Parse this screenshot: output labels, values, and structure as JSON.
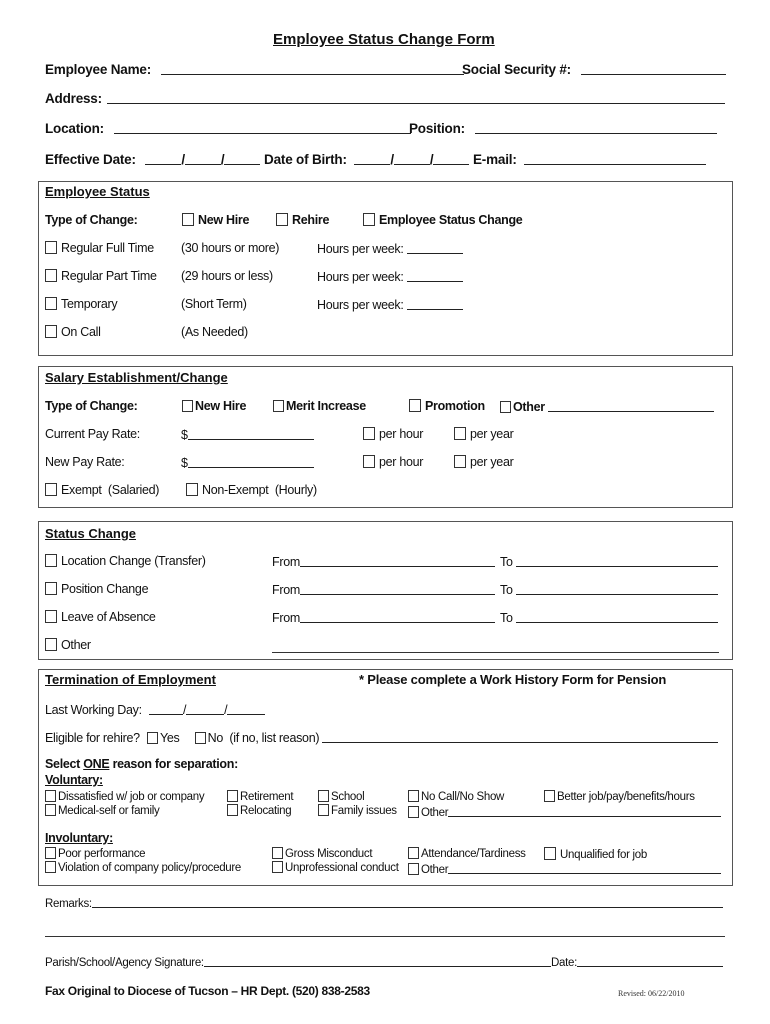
{
  "title": "Employee Status Change Form",
  "header_fields": {
    "employee_name": "Employee Name:",
    "ssn": "Social Security #:",
    "address": "Address:",
    "location": "Location:",
    "position": "Position:",
    "effective_date": "Effective Date:",
    "date_of_birth": "Date of Birth:",
    "email": "E-mail:"
  },
  "employee_status": {
    "title": "Employee Status",
    "type_of_change_label": "Type of Change:",
    "type_options": [
      "New Hire",
      "Rehire",
      "Employee Status Change"
    ],
    "rows": [
      {
        "label": "Regular Full Time",
        "note": "(30 hours or more)",
        "hours": "Hours per week:"
      },
      {
        "label": "Regular Part Time",
        "note": "(29 hours or less)",
        "hours": "Hours per week:"
      },
      {
        "label": "Temporary",
        "note": "(Short Term)",
        "hours": "Hours per week:"
      },
      {
        "label": "On Call",
        "note": "(As Needed)",
        "hours": ""
      }
    ]
  },
  "salary": {
    "title": "Salary Establishment/Change",
    "type_of_change_label": "Type of Change:",
    "type_options": [
      "New Hire",
      "Merit Increase",
      "Promotion",
      "Other"
    ],
    "current_pay": "Current Pay Rate:",
    "new_pay": "New Pay Rate:",
    "dollar": "$",
    "per_hour": "per hour",
    "per_year": "per year",
    "exempt": "Exempt  (Salaried)",
    "non_exempt": "Non-Exempt  (Hourly)"
  },
  "status_change": {
    "title": "Status Change",
    "rows": [
      {
        "label": "Location Change (Transfer)",
        "from": "From",
        "to": "To"
      },
      {
        "label": "Position Change",
        "from": "From",
        "to": "To"
      },
      {
        "label": "Leave of Absence",
        "from": "From",
        "to": "To"
      },
      {
        "label": "Other",
        "from": "",
        "to": ""
      }
    ]
  },
  "termination": {
    "title": "Termination of Employment",
    "pension_note": "* Please complete a Work History Form for Pension",
    "last_working_day": "Last Working Day:",
    "eligible_rehire": "Eligible for rehire?",
    "yes": "Yes",
    "no": "No  (if no, list reason)",
    "select_prefix": "Select ",
    "select_one": "ONE",
    "select_suffix": " reason for separation:",
    "voluntary_title": "Voluntary:",
    "voluntary": [
      [
        "Dissatisfied w/ job or company",
        "Retirement",
        "School",
        "No Call/No Show",
        "Better job/pay/benefits/hours"
      ],
      [
        "Medical-self or family",
        "Relocating",
        "Family issues",
        "Other"
      ]
    ],
    "involuntary_title": "Involuntary:",
    "involuntary": [
      [
        "Poor performance",
        "Gross Misconduct",
        "Attendance/Tardiness",
        "Unqualified for job"
      ],
      [
        "Violation of company policy/procedure",
        "Unprofessional conduct",
        "Other"
      ]
    ]
  },
  "footer": {
    "remarks": "Remarks:",
    "signature": "Parish/School/Agency Signature:",
    "date": "Date:",
    "fax": "Fax Original to Diocese of Tucson – HR Dept. (520) 838-2583",
    "revised": "Revised: 06/22/2010"
  }
}
